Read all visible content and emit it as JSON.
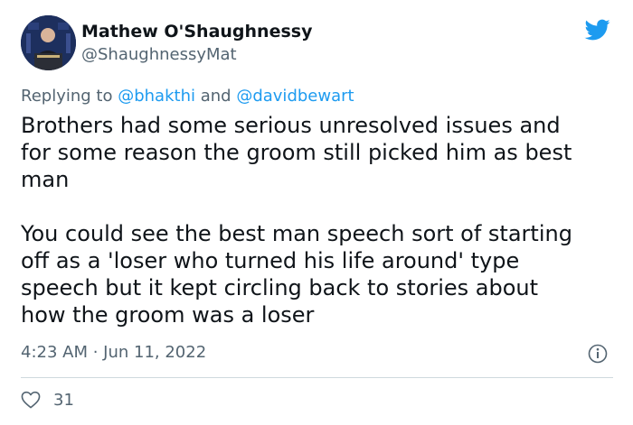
{
  "author": {
    "name": "Mathew O'Shaughnessy",
    "handle": "@ShaughnessyMat"
  },
  "reply": {
    "prefix": "Replying to",
    "mention1": "@bhakthi",
    "and": "and",
    "mention2": "@davidbewart"
  },
  "tweet": {
    "paragraph1": "Brothers had some serious unresolved issues and\nfor some reason the groom still picked him as best\nman",
    "paragraph2": "You could see the best man speech sort of starting\noff as a 'loser who turned his life around' type\nspeech but it kept circling back to stories about\nhow the groom was a loser"
  },
  "meta": {
    "time": "4:23 AM · Jun 11, 2022"
  },
  "stats": {
    "likes": "31"
  },
  "icons": {
    "brand": "twitter-bird-icon",
    "info": "info-icon",
    "like": "heart-outline-icon"
  },
  "colors": {
    "accent": "#1d9bf0",
    "text": "#0f1419",
    "muted": "#536471",
    "divider": "#cfd9de"
  }
}
